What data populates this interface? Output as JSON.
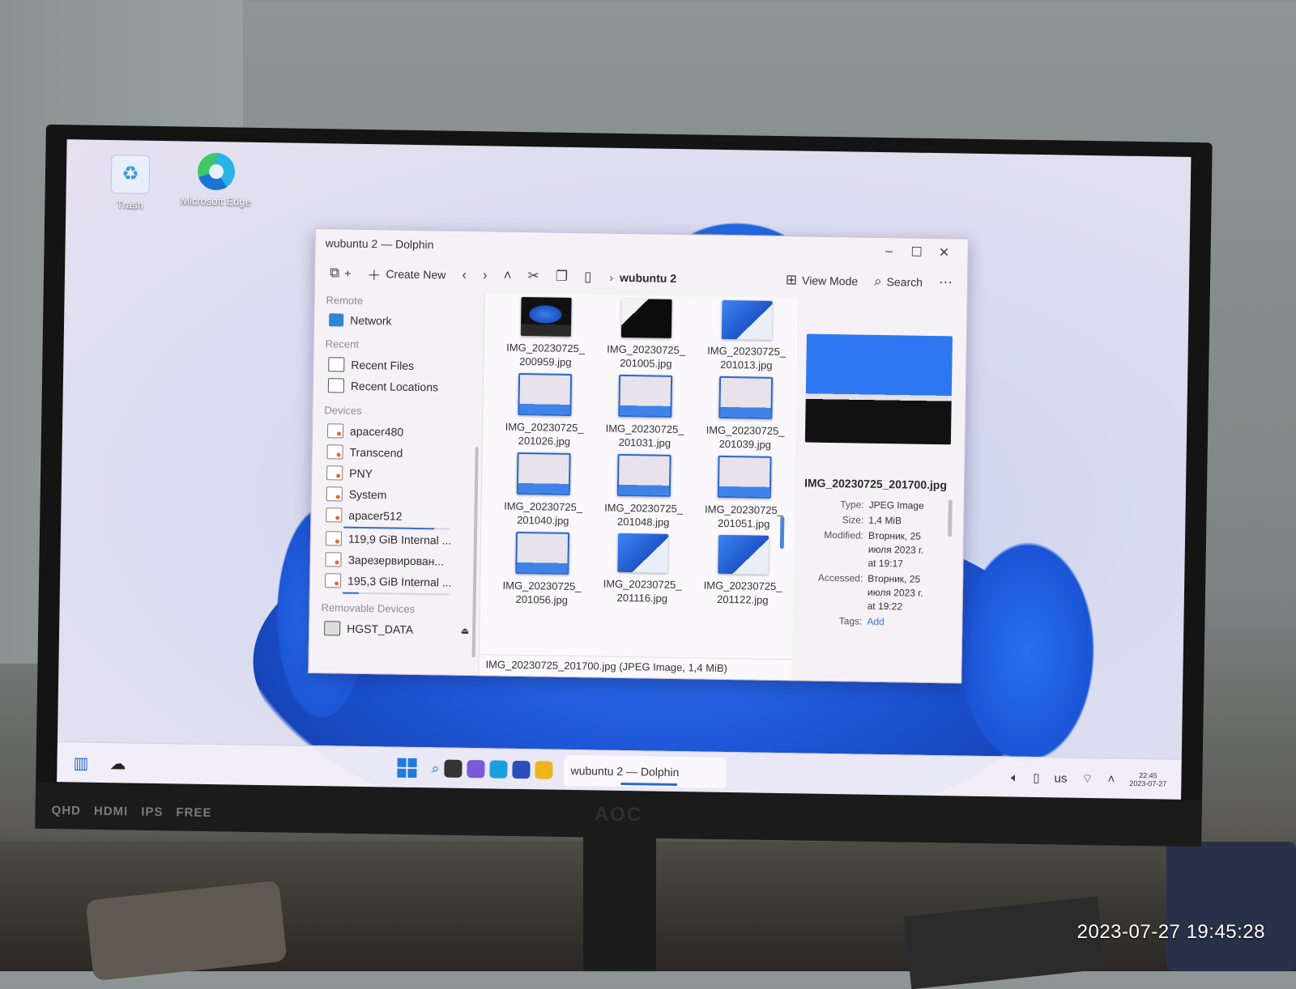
{
  "photo_timestamp": "2023-07-27 19:45:28",
  "monitor": {
    "badges": [
      "QHD",
      "HDMI",
      "IPS",
      "FREE"
    ],
    "brand": "AOC"
  },
  "desktop": {
    "icons": [
      {
        "label": "Trash",
        "icon": "trash-icon"
      },
      {
        "label": "Microsoft Edge",
        "icon": "edge-icon"
      }
    ]
  },
  "window": {
    "title": "wubuntu 2 — Dolphin",
    "toolbar": {
      "new_tab_label": "+",
      "create_new": "Create New",
      "breadcrumb": "wubuntu 2",
      "view_mode": "View Mode",
      "search": "Search"
    },
    "sidebar": {
      "remote_header": "Remote",
      "network": "Network",
      "recent_header": "Recent",
      "recent_files": "Recent Files",
      "recent_locations": "Recent Locations",
      "devices_header": "Devices",
      "devices": [
        "apacer480",
        "Transcend",
        "PNY",
        "System",
        "apacer512",
        "119,9 GiB Internal ...",
        "Зарезервирован...",
        "195,3 GiB Internal ..."
      ],
      "removable_header": "Removable Devices",
      "removable": [
        "HGST_DATA"
      ]
    },
    "files": [
      {
        "name_line1": "IMG_20230725_",
        "name_line2": "200959.jpg",
        "thumb": "dark"
      },
      {
        "name_line1": "IMG_20230725_",
        "name_line2": "201005.jpg",
        "thumb": "black"
      },
      {
        "name_line1": "IMG_20230725_",
        "name_line2": "201013.jpg",
        "thumb": "bloom"
      },
      {
        "name_line1": "IMG_20230725_",
        "name_line2": "201026.jpg",
        "thumb": "shot"
      },
      {
        "name_line1": "IMG_20230725_",
        "name_line2": "201031.jpg",
        "thumb": "shot"
      },
      {
        "name_line1": "IMG_20230725_",
        "name_line2": "201039.jpg",
        "thumb": "shot"
      },
      {
        "name_line1": "IMG_20230725_",
        "name_line2": "201040.jpg",
        "thumb": "shot"
      },
      {
        "name_line1": "IMG_20230725_",
        "name_line2": "201048.jpg",
        "thumb": "shot"
      },
      {
        "name_line1": "IMG_20230725_",
        "name_line2": "201051.jpg",
        "thumb": "shot"
      },
      {
        "name_line1": "IMG_20230725_",
        "name_line2": "201056.jpg",
        "thumb": "shot"
      },
      {
        "name_line1": "IMG_20230725_",
        "name_line2": "201116.jpg",
        "thumb": "bloom"
      },
      {
        "name_line1": "IMG_20230725_",
        "name_line2": "201122.jpg",
        "thumb": "bloom"
      }
    ],
    "statusbar": "IMG_20230725_201700.jpg (JPEG Image, 1,4 MiB)",
    "info_panel": {
      "file_name": "IMG_20230725_201700.jpg",
      "type_label": "Type:",
      "type_value": "JPEG Image",
      "size_label": "Size:",
      "size_value": "1,4 MiB",
      "modified_label": "Modified:",
      "modified_value": "Вторник, 25 июля 2023 г. at 19:17",
      "accessed_label": "Accessed:",
      "accessed_value": "Вторник, 25 июля 2023 г. at 19:22",
      "tags_label": "Tags:",
      "tags_value": "Add"
    }
  },
  "taskbar": {
    "active_task": "wubuntu 2 — Dolphin",
    "keyboard_layout": "us",
    "clock_time": "22:45",
    "clock_date": "2023-07-27"
  }
}
